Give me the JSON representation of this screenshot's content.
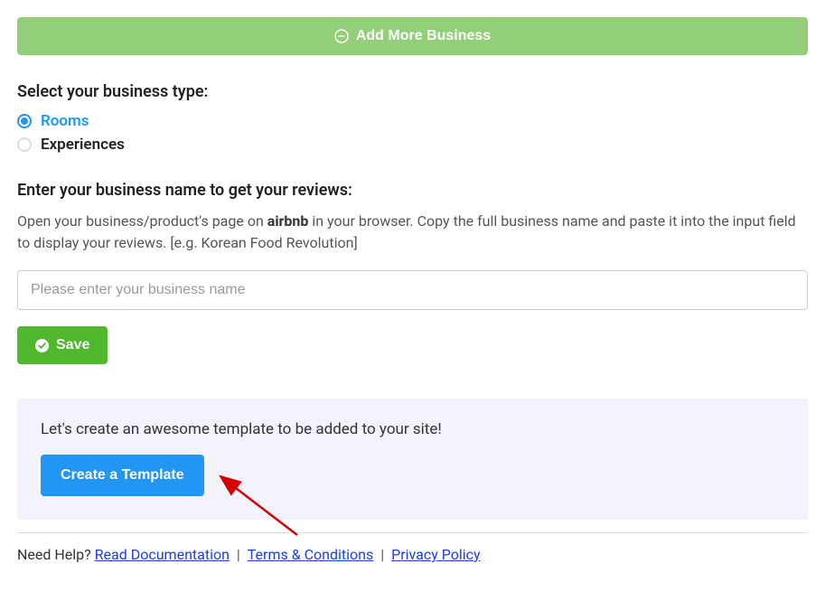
{
  "add_business": {
    "label": "Add More Business"
  },
  "business_type": {
    "label": "Select your business type:",
    "options": [
      {
        "label": "Rooms",
        "selected": true
      },
      {
        "label": "Experiences",
        "selected": false
      }
    ]
  },
  "business_name": {
    "label": "Enter your business name to get your reviews:",
    "help_prefix": "Open your business/product's page on ",
    "help_bold": "airbnb",
    "help_suffix": " in your browser. Copy the full business name and paste it into the input field to display your reviews. [e.g. Korean Food Revolution]",
    "placeholder": "Please enter your business name"
  },
  "save": {
    "label": "Save"
  },
  "template": {
    "text": "Let's create an awesome template to be added to your site!",
    "button": "Create a Template"
  },
  "footer": {
    "help_text": "Need Help? ",
    "links": {
      "docs": "Read Documentation",
      "terms": "Terms & Conditions",
      "privacy": "Privacy Policy"
    }
  }
}
